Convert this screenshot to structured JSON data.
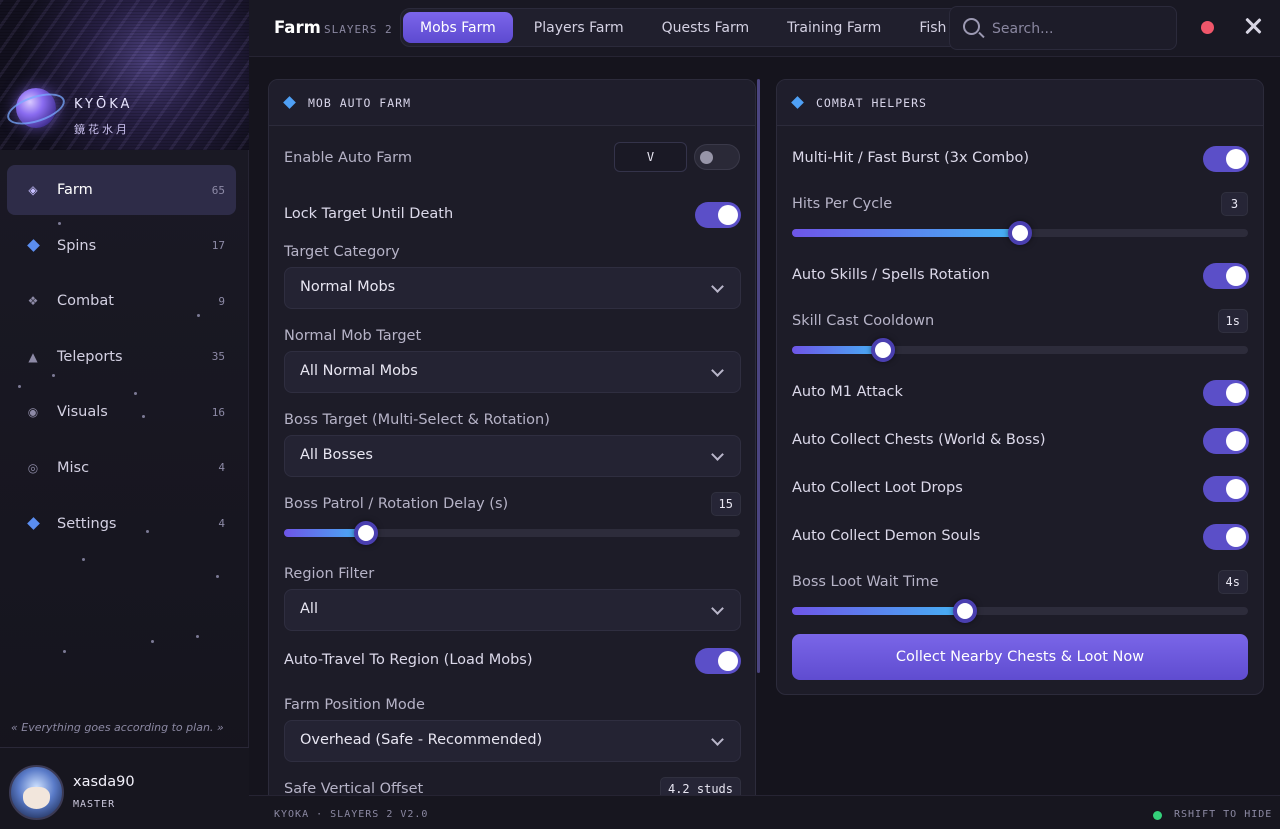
{
  "brand": {
    "name": "KYŌKA",
    "subtitle": "鏡花水月"
  },
  "sidebar": {
    "items": [
      {
        "label": "Farm",
        "count": "65",
        "icon": "diamond-outline-icon"
      },
      {
        "label": "Spins",
        "count": "17",
        "icon": "diamond-filled-icon"
      },
      {
        "label": "Combat",
        "count": "9",
        "icon": "four-diamonds-icon"
      },
      {
        "label": "Teleports",
        "count": "35",
        "icon": "triangle-icon"
      },
      {
        "label": "Visuals",
        "count": "16",
        "icon": "eye-circle-icon"
      },
      {
        "label": "Misc",
        "count": "4",
        "icon": "ring-icon"
      },
      {
        "label": "Settings",
        "count": "4",
        "icon": "diamond-filled-icon"
      }
    ],
    "active": "Farm",
    "quote": "« Everything goes according to plan. »"
  },
  "user": {
    "name": "xasda90",
    "rank": "MASTER"
  },
  "header": {
    "title": "Farm",
    "subtitle": "SLAYERS 2",
    "tabs": [
      "Mobs Farm",
      "Players Farm",
      "Quests Farm",
      "Training Farm",
      "Fish & U"
    ],
    "active_tab": "Mobs Farm",
    "search_placeholder": "Search..."
  },
  "mob_auto_farm": {
    "title": "MOB AUTO FARM",
    "enable_auto_farm": {
      "label": "Enable Auto Farm",
      "key": "V",
      "on": false
    },
    "lock_target": {
      "label": "Lock Target Until Death",
      "on": true
    },
    "target_category": {
      "label": "Target Category",
      "value": "Normal Mobs"
    },
    "normal_mob_target": {
      "label": "Normal Mob Target",
      "value": "All Normal Mobs"
    },
    "boss_target": {
      "label": "Boss Target (Multi-Select & Rotation)",
      "value": "All Bosses"
    },
    "boss_delay": {
      "label": "Boss Patrol / Rotation Delay (s)",
      "value": "15",
      "fraction": 0.18
    },
    "region_filter": {
      "label": "Region Filter",
      "value": "All"
    },
    "auto_travel": {
      "label": "Auto-Travel To Region (Load Mobs)",
      "on": true
    },
    "farm_position": {
      "label": "Farm Position Mode",
      "value": "Overhead (Safe - Recommended)"
    },
    "vertical_offset": {
      "label": "Safe Vertical Offset",
      "value": "4.2 studs"
    }
  },
  "combat_helpers": {
    "title": "COMBAT HELPERS",
    "multi_hit": {
      "label": "Multi-Hit / Fast Burst (3x Combo)",
      "on": true
    },
    "hits_per_cycle": {
      "label": "Hits Per Cycle",
      "value": "3",
      "fraction": 0.5
    },
    "auto_skills": {
      "label": "Auto Skills / Spells Rotation",
      "on": true
    },
    "skill_cooldown": {
      "label": "Skill Cast Cooldown",
      "value": "1s",
      "fraction": 0.2
    },
    "auto_m1": {
      "label": "Auto M1 Attack",
      "on": true
    },
    "auto_chests": {
      "label": "Auto Collect Chests (World & Boss)",
      "on": true
    },
    "auto_loot": {
      "label": "Auto Collect Loot Drops",
      "on": true
    },
    "auto_souls": {
      "label": "Auto Collect Demon Souls",
      "on": true
    },
    "loot_wait": {
      "label": "Boss Loot Wait Time",
      "value": "4s",
      "fraction": 0.38
    },
    "collect_button": "Collect Nearby Chests & Loot Now"
  },
  "footer": {
    "left": "KYOKA · SLAYERS 2 V2.0",
    "right": "RSHIFT TO HIDE"
  },
  "colors": {
    "accent": "#6e58e0",
    "status_online": "#34d07a",
    "record_dot": "#f0566a"
  }
}
